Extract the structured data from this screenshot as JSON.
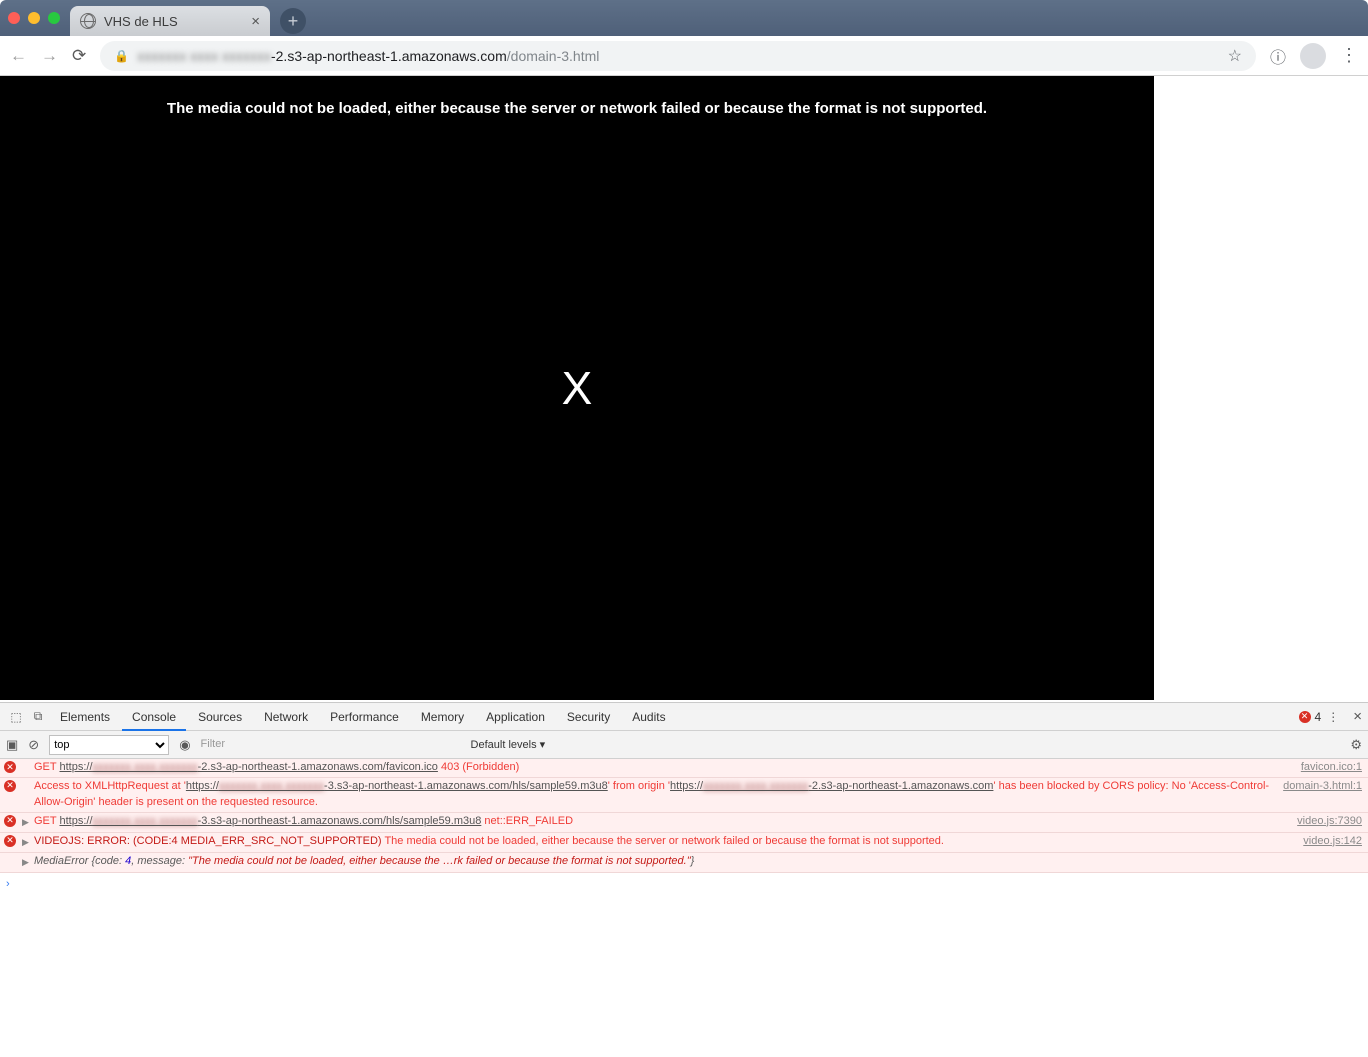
{
  "window": {
    "tab_title": "VHS de HLS",
    "url_blur": "xxxxxxx xxxx xxxxxxx",
    "url_host_suffix": "-2.s3-ap-northeast-1.amazonaws.com",
    "url_path": "/domain-3.html"
  },
  "player": {
    "error_msg": "The media could not be loaded, either because the server or network failed or because the format is not supported.",
    "big_x": "X"
  },
  "devtools": {
    "tabs": [
      "Elements",
      "Console",
      "Sources",
      "Network",
      "Performance",
      "Memory",
      "Application",
      "Security",
      "Audits"
    ],
    "active_tab": "Console",
    "error_count": "4",
    "context": "top",
    "filter_placeholder": "Filter",
    "levels": "Default levels ▾"
  },
  "console": {
    "r1": {
      "method": "GET",
      "url_prefix": "https://",
      "url_suffix": "-2.s3-ap-northeast-1.amazonaws.com/favicon.ico",
      "status": "403 (Forbidden)",
      "source": "favicon.ico:1"
    },
    "r2": {
      "pre": "Access to XMLHttpRequest at '",
      "url1_prefix": "https://",
      "url1_suffix": "-3.s3-ap-northeast-1.amazonaws.com/hls/sample59.m3u8",
      "mid": "' from origin '",
      "url2_prefix": "https://",
      "url2_suffix": "-2.s3-ap-northeast-1.amazonaws.com",
      "post": "' has been blocked by CORS policy: No 'Access-Control-Allow-Origin' header is present on the requested resource.",
      "source": "domain-3.html:1"
    },
    "r3": {
      "method": "GET",
      "url_prefix": "https://",
      "url_suffix": "-3.s3-ap-northeast-1.amazonaws.com/hls/sample59.m3u8",
      "status": "net::ERR_FAILED",
      "source": "video.js:7390"
    },
    "r4": {
      "pre": "VIDEOJS: ERROR: (CODE:4 MEDIA_ERR_SRC_NOT_SUPPORTED) ",
      "msg": "The media could not be loaded, either because the server or network failed or because the format is not supported.",
      "source": "video.js:142"
    },
    "r5": {
      "label": "MediaError ",
      "open": "{",
      "k1": "code: ",
      "v1": "4",
      "sep": ", ",
      "k2": "message: ",
      "v2": "\"The media could not be loaded, either because the …rk failed or because the format is not supported.\"",
      "close": "}"
    }
  }
}
